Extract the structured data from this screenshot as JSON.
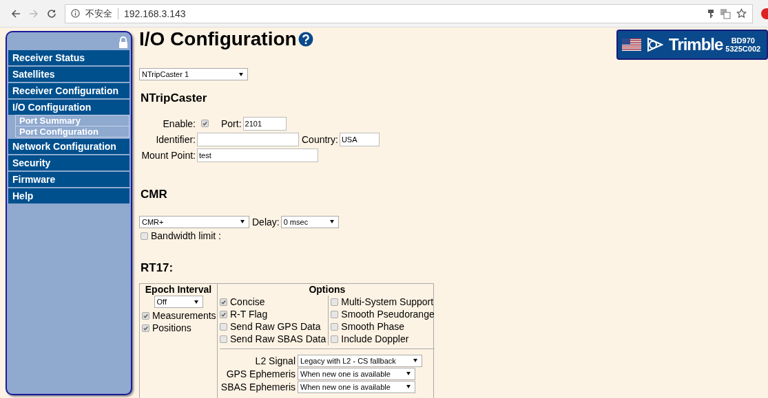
{
  "browser": {
    "security_label": "不安全",
    "url": "192.168.3.143"
  },
  "sidebar": {
    "items": [
      {
        "label": "Receiver Status"
      },
      {
        "label": "Satellites"
      },
      {
        "label": "Receiver Configuration"
      },
      {
        "label": "I/O Configuration",
        "children": [
          {
            "label": "Port Summary"
          },
          {
            "label": "Port Configuration"
          }
        ]
      },
      {
        "label": "Network Configuration"
      },
      {
        "label": "Security"
      },
      {
        "label": "Firmware"
      },
      {
        "label": "Help"
      }
    ]
  },
  "page": {
    "title": "I/O Configuration"
  },
  "banner": {
    "brand": "Trimble",
    "model": "BD970",
    "serial": "5325C002"
  },
  "port_select": {
    "value": "NTripCaster 1"
  },
  "ntrip": {
    "heading": "NTripCaster",
    "enable": {
      "label": "Enable:",
      "checked": true
    },
    "port": {
      "label": "Port:",
      "value": "2101"
    },
    "identifier": {
      "label": "Identifier:"
    },
    "country": {
      "label": "Country:",
      "value": "USA"
    },
    "mount_point": {
      "label": "Mount Point:",
      "value": "test"
    }
  },
  "cmr": {
    "heading": "CMR",
    "format": {
      "value": "CMR+"
    },
    "delay": {
      "label": "Delay:",
      "value": "0 msec"
    },
    "bandwidth_limit": {
      "label": "Bandwidth limit :",
      "checked": false
    }
  },
  "rt17": {
    "heading": "RT17:",
    "epoch_interval": {
      "heading": "Epoch Interval",
      "value": "Off",
      "checks": [
        {
          "label": "Measurements",
          "checked": true
        },
        {
          "label": "Positions",
          "checked": true
        }
      ]
    },
    "options": {
      "heading": "Options",
      "column_1": [
        {
          "label": "Concise",
          "checked": true
        },
        {
          "label": "R-T Flag",
          "checked": true
        },
        {
          "label": "Send Raw GPS Data",
          "checked": false
        },
        {
          "label": "Send Raw SBAS Data",
          "checked": false
        }
      ],
      "column_2": [
        {
          "label": "Multi-System Support",
          "checked": false
        },
        {
          "label": "Smooth Pseudorange",
          "checked": false
        },
        {
          "label": "Smooth Phase",
          "checked": false
        },
        {
          "label": "Include Doppler",
          "checked": false
        }
      ],
      "selects": [
        {
          "label": "L2 Signal",
          "value": "Legacy with L2 - CS fallback"
        },
        {
          "label": "GPS Ephemeris",
          "value": "When new one is available"
        },
        {
          "label": "SBAS Ephemeris",
          "value": "When new one is available"
        }
      ]
    }
  }
}
